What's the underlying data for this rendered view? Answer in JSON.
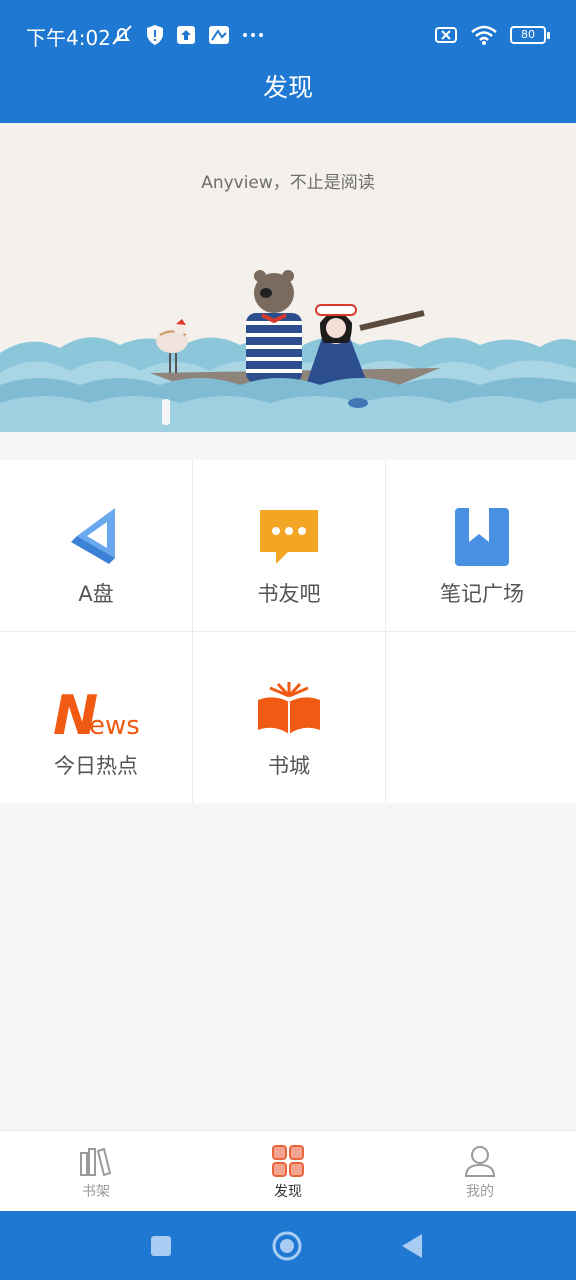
{
  "status_bar": {
    "time": "下午4:02",
    "battery": "80"
  },
  "header": {
    "title": "发现"
  },
  "banner": {
    "slogan": "Anyview，不止是阅读"
  },
  "grid": {
    "items": [
      {
        "label": "A盘",
        "icon": "a-disk-icon"
      },
      {
        "label": "书友吧",
        "icon": "chat-bubble-icon"
      },
      {
        "label": "笔记广场",
        "icon": "bookmark-icon"
      },
      {
        "label": "今日热点",
        "icon": "news-icon"
      },
      {
        "label": "书城",
        "icon": "open-book-icon"
      }
    ],
    "news_text": {
      "first": "N",
      "rest": "ews"
    }
  },
  "tabbar": {
    "tabs": [
      {
        "label": "书架",
        "icon": "bookshelf-icon",
        "active": false
      },
      {
        "label": "发现",
        "icon": "discover-grid-icon",
        "active": true
      },
      {
        "label": "我的",
        "icon": "profile-icon",
        "active": false
      }
    ]
  },
  "colors": {
    "primary": "#1f78d1",
    "accent_orange": "#f15a12",
    "chat_yellow": "#f3a623",
    "bookmark_blue": "#4a90e2"
  }
}
